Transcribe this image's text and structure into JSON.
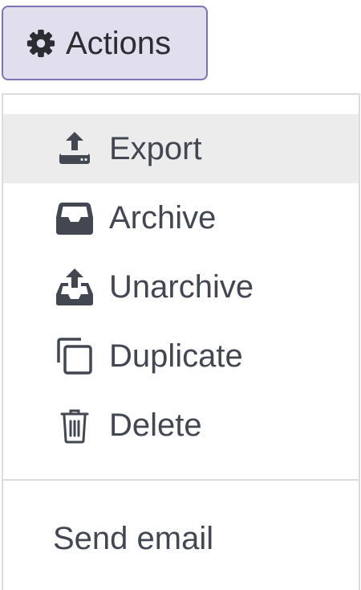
{
  "actions_button": {
    "icon": "gear-icon",
    "label": "Actions"
  },
  "menu": {
    "items": [
      {
        "icon": "export-icon",
        "label": "Export",
        "active": true
      },
      {
        "icon": "archive-icon",
        "label": "Archive",
        "active": false
      },
      {
        "icon": "unarchive-icon",
        "label": "Unarchive",
        "active": false
      },
      {
        "icon": "duplicate-icon",
        "label": "Duplicate",
        "active": false
      },
      {
        "icon": "trash-icon",
        "label": "Delete",
        "active": false
      }
    ],
    "send_email": {
      "label": "Send email"
    }
  },
  "colors": {
    "button_bg": "#e1dfed",
    "button_border": "#7e74b4",
    "text": "#424751",
    "active_row": "#ececec",
    "border": "#dcdcdc"
  }
}
